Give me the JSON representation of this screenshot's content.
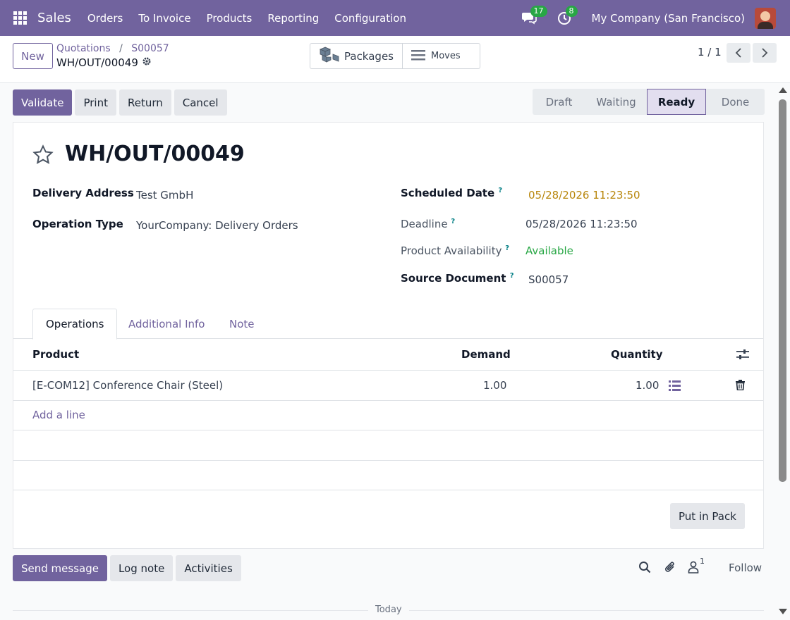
{
  "navbar": {
    "brand": "Sales",
    "menu": [
      "Orders",
      "To Invoice",
      "Products",
      "Reporting",
      "Configuration"
    ],
    "messages_badge": "17",
    "activities_badge": "8",
    "company": "My Company (San Francisco)"
  },
  "control_panel": {
    "new_label": "New",
    "breadcrumb": [
      "Quotations",
      "S00057"
    ],
    "record_name": "WH/OUT/00049",
    "smart_buttons": {
      "packages": "Packages",
      "moves": "Moves"
    },
    "pager": "1 / 1"
  },
  "actions": [
    "Validate",
    "Print",
    "Return",
    "Cancel"
  ],
  "statusbar": {
    "stages": [
      "Draft",
      "Waiting",
      "Ready",
      "Done"
    ],
    "current": "Ready"
  },
  "form": {
    "title": "WH/OUT/00049",
    "fields": {
      "delivery_address": {
        "label": "Delivery Address",
        "value": "Test GmbH"
      },
      "operation_type": {
        "label": "Operation Type",
        "value": "YourCompany: Delivery Orders"
      },
      "scheduled_date": {
        "label": "Scheduled Date",
        "value": "05/28/2026 11:23:50"
      },
      "deadline": {
        "label": "Deadline",
        "value": "05/28/2026 11:23:50"
      },
      "availability": {
        "label": "Product Availability",
        "value": "Available"
      },
      "source_document": {
        "label": "Source Document",
        "value": "S00057"
      }
    },
    "help_mark": "?",
    "tabs": [
      "Operations",
      "Additional Info",
      "Note"
    ],
    "table": {
      "headers": {
        "product": "Product",
        "demand": "Demand",
        "quantity": "Quantity"
      },
      "rows": [
        {
          "product": "[E-COM12] Conference Chair (Steel)",
          "demand": "1.00",
          "quantity": "1.00"
        }
      ],
      "add_line": "Add a line"
    },
    "put_in_pack": "Put in Pack"
  },
  "chatter": {
    "buttons": [
      "Send message",
      "Log note",
      "Activities"
    ],
    "followers_count": "1",
    "follow_label": "Follow",
    "today": "Today"
  },
  "colors": {
    "primary": "#71639e",
    "success": "#28a745",
    "warning": "#b8860b"
  }
}
